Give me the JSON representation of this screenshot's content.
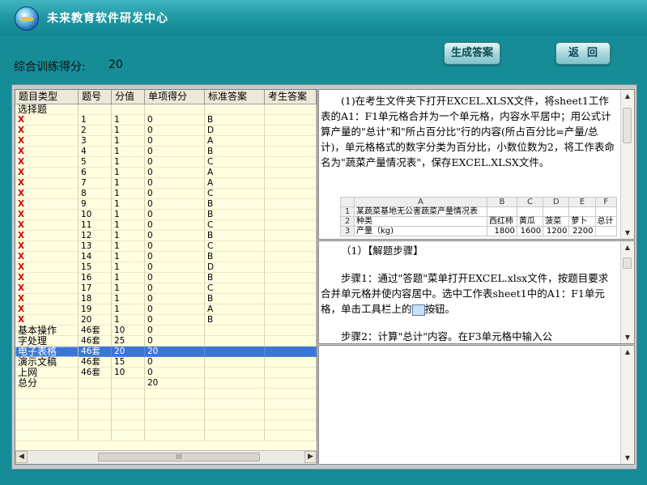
{
  "window": {
    "title": "未来教育软件研发中心",
    "logo_icon": "globe-logo-icon",
    "colors": {
      "background": "#148b95",
      "titlebar": "#1c95a0",
      "selection": "#3a76d4",
      "mark": "#d00000"
    }
  },
  "toolbar": {
    "score_label": "综合训练得分:",
    "score_value": "20",
    "generate_label": "生成答案",
    "back_label": "返回"
  },
  "grid": {
    "columns": [
      "题目类型",
      "题号",
      "分值",
      "单项得分",
      "标准答案",
      "考生答案"
    ],
    "rows": [
      {
        "type": "选择题",
        "num": "",
        "value": "",
        "score": "",
        "std": "",
        "ans": ""
      },
      {
        "type": "X",
        "num": "1",
        "value": "1",
        "score": "0",
        "std": "B",
        "ans": ""
      },
      {
        "type": "X",
        "num": "2",
        "value": "1",
        "score": "0",
        "std": "D",
        "ans": ""
      },
      {
        "type": "X",
        "num": "3",
        "value": "1",
        "score": "0",
        "std": "A",
        "ans": ""
      },
      {
        "type": "X",
        "num": "4",
        "value": "1",
        "score": "0",
        "std": "B",
        "ans": ""
      },
      {
        "type": "X",
        "num": "5",
        "value": "1",
        "score": "0",
        "std": "C",
        "ans": ""
      },
      {
        "type": "X",
        "num": "6",
        "value": "1",
        "score": "0",
        "std": "A",
        "ans": ""
      },
      {
        "type": "X",
        "num": "7",
        "value": "1",
        "score": "0",
        "std": "A",
        "ans": ""
      },
      {
        "type": "X",
        "num": "8",
        "value": "1",
        "score": "0",
        "std": "C",
        "ans": ""
      },
      {
        "type": "X",
        "num": "9",
        "value": "1",
        "score": "0",
        "std": "B",
        "ans": ""
      },
      {
        "type": "X",
        "num": "10",
        "value": "1",
        "score": "0",
        "std": "B",
        "ans": ""
      },
      {
        "type": "X",
        "num": "11",
        "value": "1",
        "score": "0",
        "std": "C",
        "ans": ""
      },
      {
        "type": "X",
        "num": "12",
        "value": "1",
        "score": "0",
        "std": "B",
        "ans": ""
      },
      {
        "type": "X",
        "num": "13",
        "value": "1",
        "score": "0",
        "std": "C",
        "ans": ""
      },
      {
        "type": "X",
        "num": "14",
        "value": "1",
        "score": "0",
        "std": "B",
        "ans": ""
      },
      {
        "type": "X",
        "num": "15",
        "value": "1",
        "score": "0",
        "std": "D",
        "ans": ""
      },
      {
        "type": "X",
        "num": "16",
        "value": "1",
        "score": "0",
        "std": "B",
        "ans": ""
      },
      {
        "type": "X",
        "num": "17",
        "value": "1",
        "score": "0",
        "std": "C",
        "ans": ""
      },
      {
        "type": "X",
        "num": "18",
        "value": "1",
        "score": "0",
        "std": "B",
        "ans": ""
      },
      {
        "type": "X",
        "num": "19",
        "value": "1",
        "score": "0",
        "std": "A",
        "ans": ""
      },
      {
        "type": "X",
        "num": "20",
        "value": "1",
        "score": "0",
        "std": "B",
        "ans": ""
      },
      {
        "type": "基本操作",
        "num": "46套",
        "value": "10",
        "score": "0",
        "std": "",
        "ans": ""
      },
      {
        "type": "字处理",
        "num": "46套",
        "value": "25",
        "score": "0",
        "std": "",
        "ans": ""
      },
      {
        "type": "电子表格",
        "num": "46套",
        "value": "20",
        "score": "20",
        "std": "",
        "ans": "",
        "selected": true
      },
      {
        "type": "演示文稿",
        "num": "46套",
        "value": "15",
        "score": "0",
        "std": "",
        "ans": ""
      },
      {
        "type": "上网",
        "num": "46套",
        "value": "10",
        "score": "0",
        "std": "",
        "ans": ""
      },
      {
        "type": "总分",
        "num": "",
        "value": "",
        "score": "20",
        "std": "",
        "ans": ""
      }
    ],
    "scroll_grip": "III"
  },
  "question": {
    "text": "(1)在考生文件夹下打开EXCEL.XLSX文件，将sheet1工作表的A1：F1单元格合并为一个单元格，内容水平居中；用公式计算产量的\"总计\"和\"所占百分比\"行的内容(所占百分比=产量/总计)，单元格格式的数字分类为百分比，小数位数为2，将工作表命名为\"蔬菜产量情况表\"，保存EXCEL.XLSX文件。",
    "excel": {
      "columns": [
        "A",
        "B",
        "C",
        "D",
        "E",
        "F"
      ],
      "rows": [
        {
          "n": "1",
          "cells": [
            "某蔬菜基地无公害蔬菜产量情况表",
            "",
            "",
            "",
            "",
            ""
          ]
        },
        {
          "n": "2",
          "cells": [
            "种类",
            "西红柿",
            "黄瓜",
            "菠菜",
            "萝卜",
            "总计"
          ]
        },
        {
          "n": "3",
          "cells": [
            "产量（kg)",
            "1800",
            "1600",
            "1200",
            "2200",
            ""
          ]
        }
      ]
    }
  },
  "solution": {
    "heading": "（1）【解题步骤】",
    "step1_a": "步骤1：通过\"答题\"菜单打开EXCEL.xlsx文件，按题目要求合并单元格并使内容居中。选中工作表sheet1中的A1：F1单元格，单击工具栏上的",
    "step1_b": "按钮。",
    "step2": "步骤2：计算\"总计\"内容。在F3单元格中输入公"
  },
  "notes": {
    "text": ""
  }
}
